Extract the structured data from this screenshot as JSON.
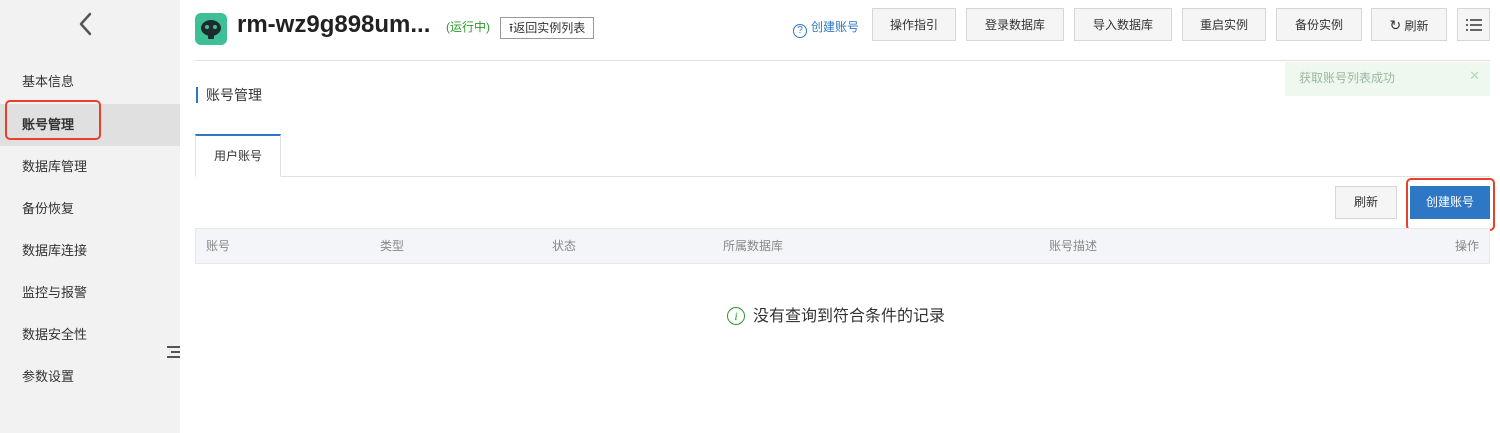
{
  "sidebar": {
    "items": [
      {
        "label": "基本信息"
      },
      {
        "label": "账号管理"
      },
      {
        "label": "数据库管理"
      },
      {
        "label": "备份恢复"
      },
      {
        "label": "数据库连接"
      },
      {
        "label": "监控与报警"
      },
      {
        "label": "数据安全性"
      },
      {
        "label": "参数设置"
      }
    ],
    "active_index": 1
  },
  "header": {
    "instance_name": "rm-wz9g898um...",
    "status": "(运行中)",
    "back_to_list": "返回实例列表",
    "help_link": "创建账号",
    "buttons": {
      "guide": "操作指引",
      "login_db": "登录数据库",
      "import_db": "导入数据库",
      "restart": "重启实例",
      "backup": "备份实例",
      "refresh": "刷新"
    }
  },
  "toast": {
    "message": "获取账号列表成功"
  },
  "section": {
    "title": "账号管理"
  },
  "tabs": [
    {
      "label": "用户账号"
    }
  ],
  "actions": {
    "refresh": "刷新",
    "create_account": "创建账号"
  },
  "table": {
    "columns": [
      "账号",
      "类型",
      "状态",
      "所属数据库",
      "账号描述",
      "操作"
    ],
    "rows": [],
    "empty_message": "没有查询到符合条件的记录"
  },
  "colors": {
    "accent": "#2d77c5",
    "success": "#2b9a2b",
    "highlight": "#e8402b",
    "logo": "#3fbf96"
  }
}
